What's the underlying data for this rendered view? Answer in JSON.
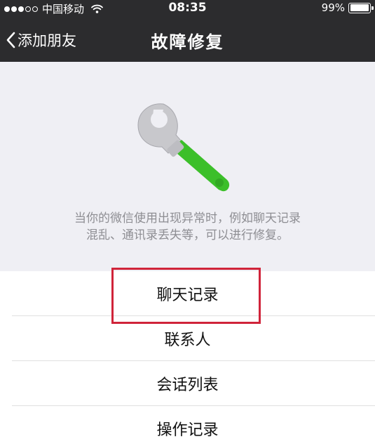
{
  "status_bar": {
    "carrier": "中国移动",
    "time": "08:35",
    "battery": "99%",
    "signal_icon": "signal-dots-icon",
    "wifi_icon": "wifi-icon",
    "battery_icon": "battery-icon"
  },
  "nav": {
    "back_label": "添加朋友",
    "title": "故障修复"
  },
  "hero": {
    "icon": "wrench-icon",
    "description_line1": "当你的微信使用出现异常时，例如聊天记录",
    "description_line2": "混乱、通讯录丢失等，可以进行修复。"
  },
  "list": {
    "items": [
      {
        "label": "聊天记录"
      },
      {
        "label": "联系人"
      },
      {
        "label": "会话列表"
      },
      {
        "label": "操作记录"
      }
    ]
  },
  "colors": {
    "nav_bg": "#2c2c2e",
    "hero_bg": "#efeff4",
    "wrench_handle": "#3cbf2a",
    "highlight_border": "#d0243a"
  }
}
